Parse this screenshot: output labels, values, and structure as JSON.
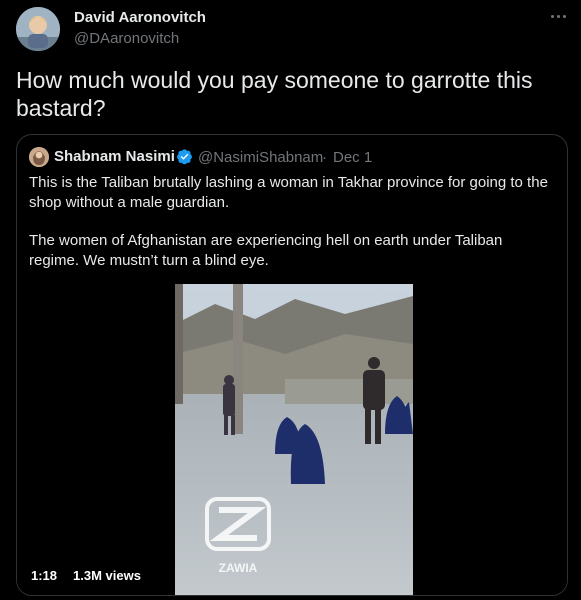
{
  "author": {
    "name": "David Aaronovitch",
    "handle": "@DAaronovitch"
  },
  "tweet": {
    "text_line1": "How much would you pay someone to garrotte this",
    "text_line2": "bastard?"
  },
  "quoted": {
    "name": "Shabnam Nasimi",
    "handle": "@NasimiShabnam",
    "separator": "·",
    "date": "Dec 1",
    "para1_line1": "This is the Taliban brutally lashing a woman in Takhar province for going to the",
    "para1_line2": "shop without a male guardian.",
    "para2_line1": "The women of Afghanistan are experiencing hell on earth under Taliban",
    "para2_line2": "regime. We mustn’t turn a blind eye.",
    "video": {
      "duration": "1:18",
      "views": "1.3M views",
      "watermark": "ZAWIA"
    }
  },
  "colors": {
    "background": "#000000",
    "text": "#e7e9ea",
    "secondary": "#71767b",
    "border": "#2f3336",
    "verified": "#1d9bf0"
  },
  "icons": [
    "more-icon",
    "verified-badge-icon"
  ]
}
